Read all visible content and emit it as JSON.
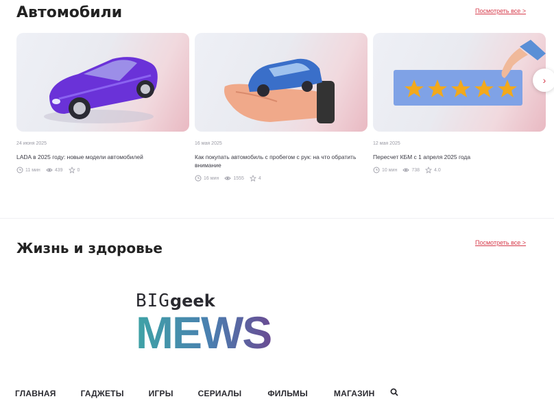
{
  "sections": {
    "cars": {
      "title": "Автомобили",
      "see_all": "Посмотреть все >"
    },
    "health": {
      "title": "Жизнь и здоровье",
      "see_all": "Посмотреть все >"
    }
  },
  "cards": [
    {
      "date": "24 июня 2025",
      "title": "LADA в 2025 году: новые модели автомобилей",
      "read_time": "11 мин",
      "views": "439",
      "rating": "0",
      "image": "purple-sports-car"
    },
    {
      "date": "16 мая 2025",
      "title": "Как покупать автомобиль с пробегом с рук: на что обратить внимание",
      "read_time": "16 мин",
      "views": "1555",
      "rating": "4",
      "image": "hand-holding-car"
    },
    {
      "date": "12 мая 2025",
      "title": "Пересчет КБМ с 1 апреля 2025 года",
      "read_time": "10 мин",
      "views": "738",
      "rating": "4.0",
      "image": "five-star-rating"
    }
  ],
  "logo": {
    "line1": "BIG",
    "line1b": "geek",
    "line2": "MEWS"
  },
  "nav": {
    "items": [
      "ГЛАВНАЯ",
      "ГАДЖЕТЫ",
      "ИГРЫ",
      "СЕРИАЛЫ",
      "ФИЛЬМЫ",
      "МАГАЗИН"
    ],
    "search_icon": "search-icon"
  },
  "colors": {
    "accent": "#d63a4a",
    "logo_teal": "#3fa3a6",
    "logo_purple": "#6a4c93"
  }
}
